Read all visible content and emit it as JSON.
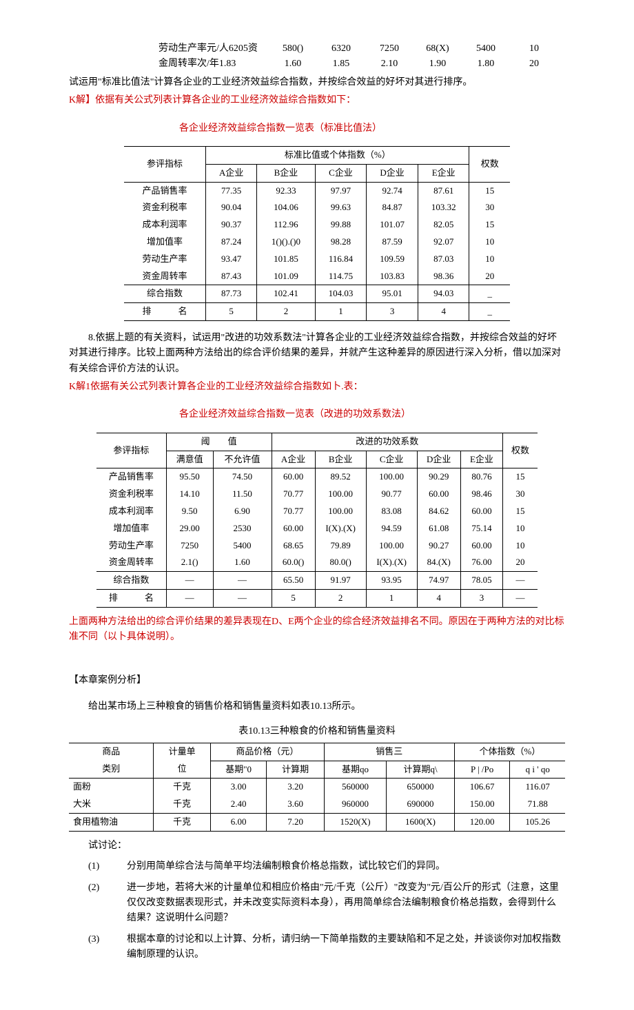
{
  "top_rows": {
    "r1": {
      "label": "劳动生产率元/人6205资",
      "v1": "580()",
      "v2": "6320",
      "v3": "7250",
      "v4": "68(X)",
      "v5": "5400",
      "v6": "10"
    },
    "r2": {
      "label": "金周转率次/年1.83",
      "v1": "1.60",
      "v2": "1.85",
      "v3": "2.10",
      "v4": "1.90",
      "v5": "1.80",
      "v6": "20"
    }
  },
  "p_intro1": "试运用\"标准比值法\"计算各企业的工业经济效益综合指数，并按综合效益的好坏对其进行排序。",
  "p_solution1": "K解】依据有关公式列表计算各企业的工业经济效益综合指数如下：",
  "caption1": "各企业经济效益综合指数一览表（标准比值法）",
  "tbl1": {
    "h_indicator": "参评指标",
    "h_group": "标准比值或个体指数（%）",
    "h_weight": "权数",
    "cols": {
      "a": "A企业",
      "b": "B企业",
      "c": "C企业",
      "d": "D企业",
      "e": "E企业"
    },
    "rows": [
      {
        "name": "产品销售率",
        "a": "77.35",
        "b": "92.33",
        "c": "97.97",
        "d": "92.74",
        "e": "87.61",
        "w": "15"
      },
      {
        "name": "资金利税率",
        "a": "90.04",
        "b": "104.06",
        "c": "99.63",
        "d": "84.87",
        "e": "103.32",
        "w": "30"
      },
      {
        "name": "成本利润率",
        "a": "90.37",
        "b": "112.96",
        "c": "99.88",
        "d": "101.07",
        "e": "82.05",
        "w": "15"
      },
      {
        "name": "增加值率",
        "a": "87.24",
        "b": "1()().()0",
        "c": "98.28",
        "d": "87.59",
        "e": "92.07",
        "w": "10"
      },
      {
        "name": "劳动生产率",
        "a": "93.47",
        "b": "101.85",
        "c": "116.84",
        "d": "109.59",
        "e": "87.03",
        "w": "10"
      },
      {
        "name": "资金周转率",
        "a": "87.43",
        "b": "101.09",
        "c": "114.75",
        "d": "103.83",
        "e": "98.36",
        "w": "20"
      }
    ],
    "composite": {
      "name": "综合指数",
      "a": "87.73",
      "b": "102.41",
      "c": "104.03",
      "d": "95.01",
      "e": "94.03",
      "w": "_"
    },
    "rank": {
      "name": "排　　　名",
      "a": "5",
      "b": "2",
      "c": "1",
      "d": "3",
      "e": "4",
      "w": "_"
    }
  },
  "p_q8": "8.依据上题的有关资料，试运用\"改进的功效系数法\"计算各企业的工业经济效益综合指数，并按综合效益的好坏对其进行排序。比较上面两种方法给出的综合评价结果的差异，并就产生这种差异的原因进行深入分析，借以加深对有关综合评价方法的认识。",
  "p_solution2": "K解1依据有关公式列表计算各企业的工业经济效益综合指数如卜.表：",
  "caption2": "各企业经济效益综合指数一览表（改进的功效系数法）",
  "tbl2": {
    "h_indicator": "参评指标",
    "h_threshold": "阈　　值",
    "h_coef": "改进的功效系数",
    "h_weight": "权数",
    "tcols": {
      "ok": "满意值",
      "bad": "不允许值"
    },
    "cols": {
      "a": "A企业",
      "b": "B企业",
      "c": "C企业",
      "d": "D企业",
      "e": "E企业"
    },
    "rows": [
      {
        "name": "产品销售率",
        "ok": "95.50",
        "bad": "74.50",
        "a": "60.00",
        "b": "89.52",
        "c": "100.00",
        "d": "90.29",
        "e": "80.76",
        "w": "15"
      },
      {
        "name": "资金利税率",
        "ok": "14.10",
        "bad": "11.50",
        "a": "70.77",
        "b": "100.00",
        "c": "90.77",
        "d": "60.00",
        "e": "98.46",
        "w": "30"
      },
      {
        "name": "成本利润率",
        "ok": "9.50",
        "bad": "6.90",
        "a": "70.77",
        "b": "100.00",
        "c": "83.08",
        "d": "84.62",
        "e": "60.00",
        "w": "15"
      },
      {
        "name": "增加值率",
        "ok": "29.00",
        "bad": "2530",
        "a": "60.00",
        "b": "I(X).(X)",
        "c": "94.59",
        "d": "61.08",
        "e": "75.14",
        "w": "10"
      },
      {
        "name": "劳动生产率",
        "ok": "7250",
        "bad": "5400",
        "a": "68.65",
        "b": "79.89",
        "c": "100.00",
        "d": "90.27",
        "e": "60.00",
        "w": "10"
      },
      {
        "name": "资金周转率",
        "ok": "2.1()",
        "bad": "1.60",
        "a": "60.0()",
        "b": "80.0()",
        "c": "I(X).(X)",
        "d": "84.(X)",
        "e": "76.00",
        "w": "20"
      }
    ],
    "composite": {
      "name": "综合指数",
      "ok": "—",
      "bad": "—",
      "a": "65.50",
      "b": "91.97",
      "c": "93.95",
      "d": "74.97",
      "e": "78.05",
      "w": "—"
    },
    "rank": {
      "name": "排　　　名",
      "ok": "—",
      "bad": "—",
      "a": "5",
      "b": "2",
      "c": "1",
      "d": "4",
      "e": "3",
      "w": "—"
    }
  },
  "p_diff": "上面两种方法给出的综合评价结果的差异表现在D、E两个企业的综合经济效益排名不同。原因在于两种方法的对比标准不同（以卜具体说明）。",
  "h_case": "【本章案例分析】",
  "p_case_intro": "给出某市场上三种粮食的销售价格和销售量资料如表10.13所示。",
  "caption3": "表10.13三种粮食的价格和销售量资料",
  "tbl3": {
    "h_product": "商品",
    "h_unit": "计量单",
    "h_price": "商品价格（元）",
    "h_sales": "销售三",
    "h_index": "个体指数（%）",
    "h_product2": "类别",
    "h_unit2": "位",
    "h_base": "基期\"0",
    "h_calc": "计算期",
    "h_baseq": "基期qo",
    "h_calcq": "计算期q\\",
    "h_pp": "P | /Po",
    "h_qq": "q i ' qo",
    "rows": [
      {
        "name": "面粉",
        "unit": "千克",
        "p0": "3.00",
        "p1": "3.20",
        "q0": "560000",
        "q1": "650000",
        "ip": "106.67",
        "iq": "116.07"
      },
      {
        "name": "大米",
        "unit": "千克",
        "p0": "2.40",
        "p1": "3.60",
        "q0": "960000",
        "q1": "690000",
        "ip": "150.00",
        "iq": "71.88"
      },
      {
        "name": "食用植物油",
        "unit": "千克",
        "p0": "6.00",
        "p1": "7.20",
        "q0": "1520(X)",
        "q1": "1600(X)",
        "ip": "120.00",
        "iq": "105.26"
      }
    ]
  },
  "p_discuss": "试讨论：",
  "discuss": {
    "n1": "(1)",
    "t1": "分别用简单综合法与简单平均法编制粮食价格总指数，试比较它们的异同。",
    "n2": "(2)",
    "t2": "进一步地，若将大米的计量单位和相应价格由\"元/千克（公斤）\"改变为\"元/百公斤的形式（注意，这里仅仅改变数据表现形式，并未改变实际资料本身），再用简单综合法编制粮食价格总指数，会得到什么结果？这说明什么问题？",
    "n3": "(3)",
    "t3": "根据本章的讨论和以上计算、分析，请归纳一下简单指数的主要缺陷和不足之处，并谈谈你对加权指数编制原理的认识。"
  }
}
